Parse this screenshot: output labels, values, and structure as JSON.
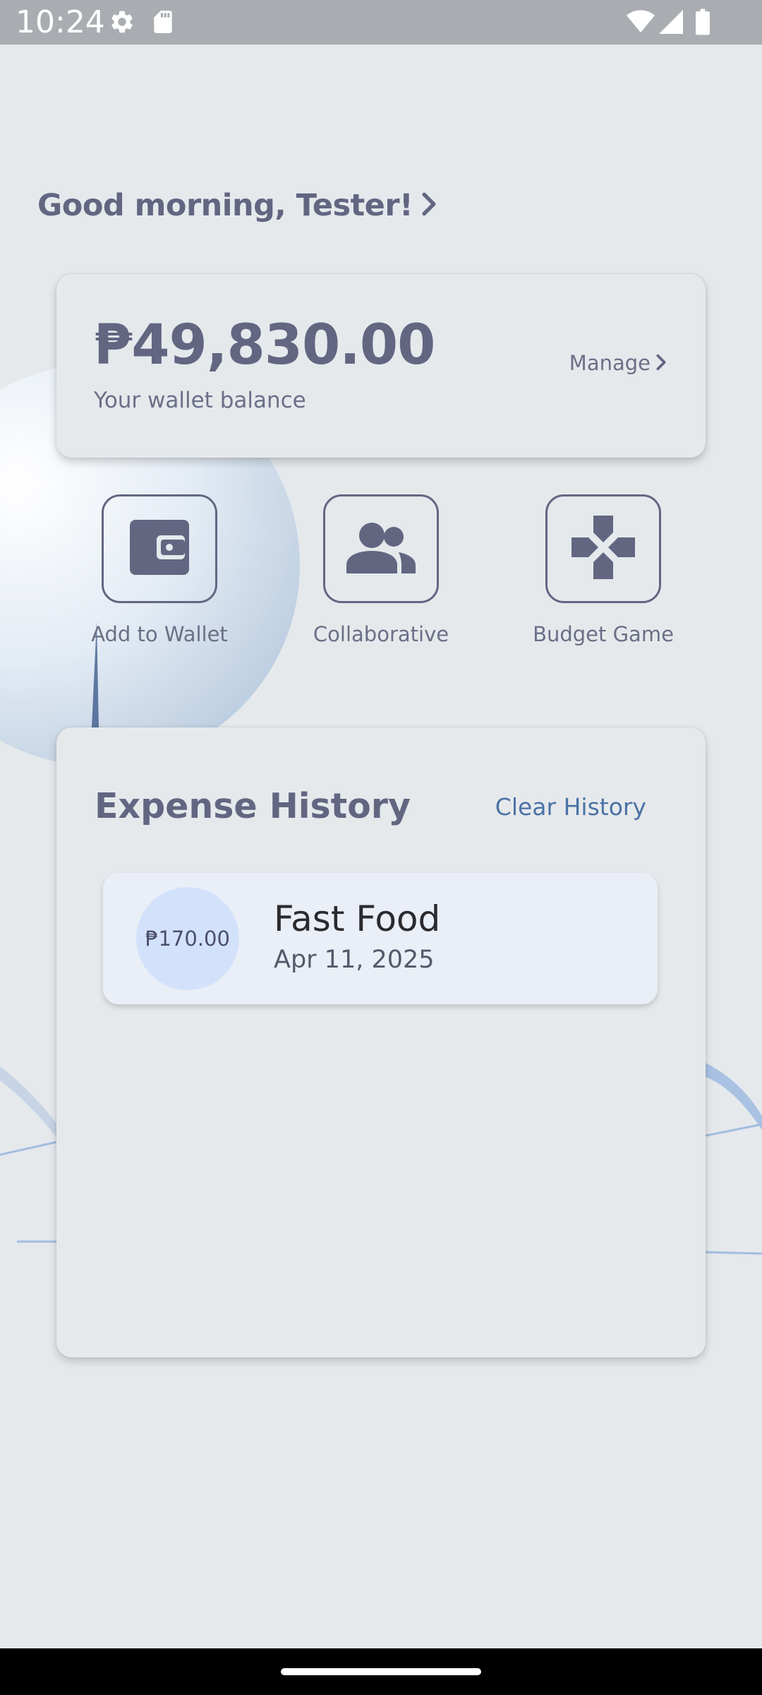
{
  "status_bar": {
    "time": "10:24",
    "icons": [
      "settings-icon",
      "sd-card-icon",
      "wifi-icon",
      "signal-icon",
      "battery-icon"
    ]
  },
  "greeting": {
    "text": "Good morning, Tester!"
  },
  "wallet": {
    "balance": "₱49,830.00",
    "label": "Your wallet balance",
    "manage_label": "Manage"
  },
  "actions": [
    {
      "label": "Add to Wallet",
      "icon": "wallet-icon"
    },
    {
      "label": "Collaborative",
      "icon": "people-icon"
    },
    {
      "label": "Budget Game",
      "icon": "gamepad-icon"
    }
  ],
  "history": {
    "title": "Expense History",
    "clear_label": "Clear History",
    "items": [
      {
        "amount": "₱170.00",
        "name": "Fast Food",
        "date": "Apr 11, 2025"
      }
    ]
  },
  "colors": {
    "background": "#e5e9ec",
    "primary_text": "#636681",
    "link": "#4a72a5",
    "amount_circle": "#d3e2fb",
    "status_bar": "#a9adb1"
  }
}
